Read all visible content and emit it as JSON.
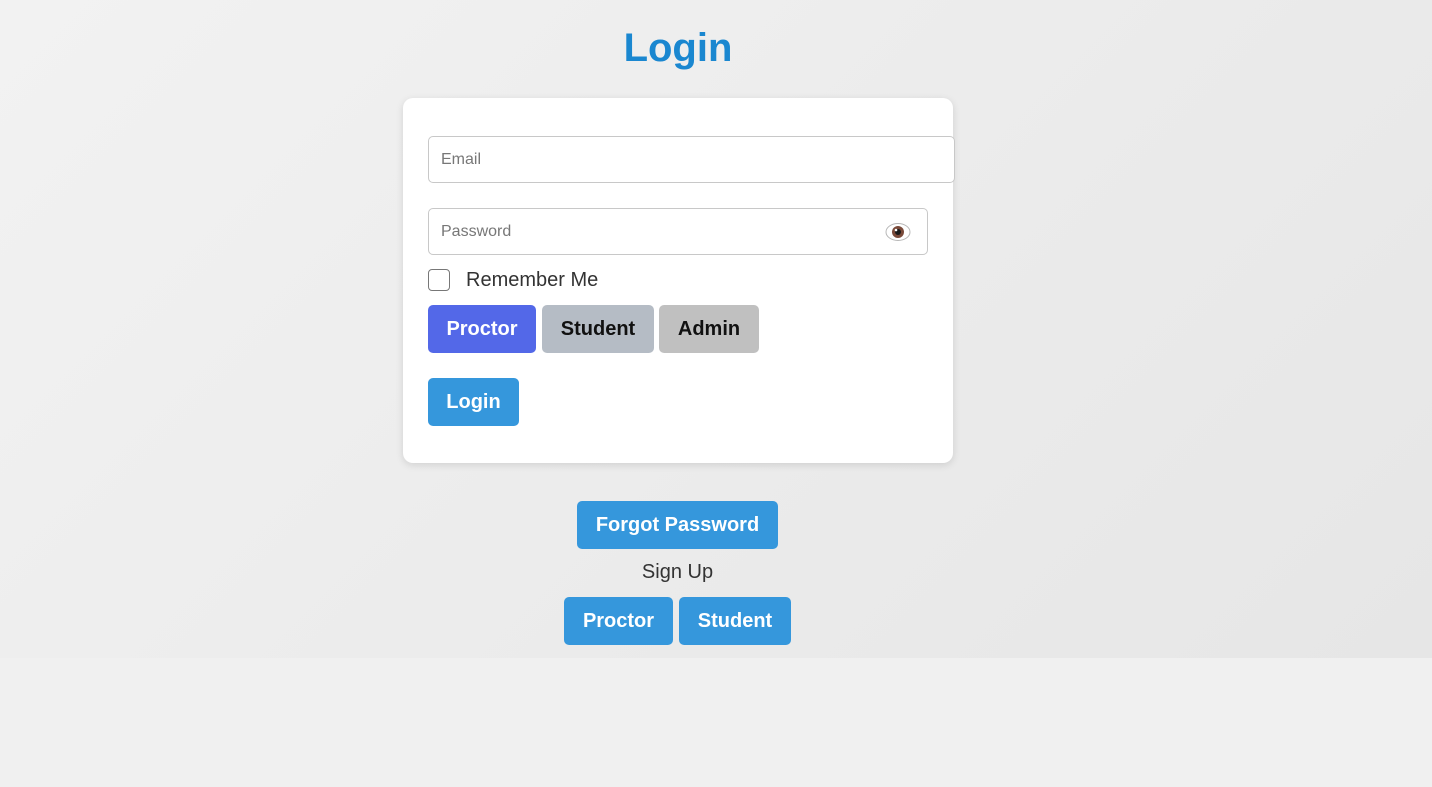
{
  "page": {
    "title": "Login"
  },
  "form": {
    "email_placeholder": "Email",
    "email_value": "",
    "password_placeholder": "Password",
    "password_value": "",
    "password_toggle_icon": "eye-icon",
    "remember_label": "Remember Me",
    "remember_checked": false,
    "roles": [
      {
        "label": "Proctor",
        "selected": true,
        "color": "#5368e8"
      },
      {
        "label": "Student",
        "selected": false,
        "color": "#b5bcc5"
      },
      {
        "label": "Admin",
        "selected": false,
        "color": "#c0c0c0"
      }
    ],
    "login_label": "Login"
  },
  "footer": {
    "forgot_label": "Forgot Password",
    "signup_label": "Sign Up",
    "signup_buttons": [
      {
        "label": "Proctor"
      },
      {
        "label": "Student"
      }
    ]
  },
  "colors": {
    "title": "#1a87d0",
    "primary_button": "#3597dc",
    "selected_role": "#5368e8"
  }
}
